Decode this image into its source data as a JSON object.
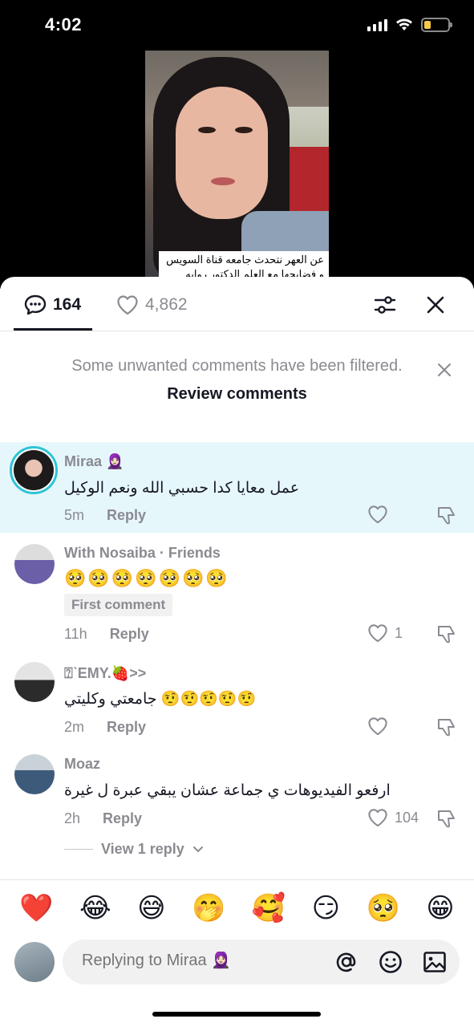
{
  "status": {
    "time": "4:02"
  },
  "video": {
    "caption_line1": "عن العهر نتحدث جامعه قناة السويس",
    "caption_line2": "و فضايحها مع العلم الدكتور روايه"
  },
  "tabs": {
    "comments_count": "164",
    "likes_count": "4,862"
  },
  "notice": {
    "text": "Some unwanted comments have been filtered.",
    "link": "Review comments"
  },
  "comments": [
    {
      "name": "Miraa 🧕🏻",
      "text": "عمل معايا كدا حسبي الله ونعم الوكيل",
      "time": "5m",
      "reply": "Reply",
      "likes": ""
    },
    {
      "name": "With Nosaiba · Friends",
      "emojis": "🥺🥺🥺🥺🥺🥺🥺",
      "badge": "First comment",
      "time": "11h",
      "reply": "Reply",
      "likes": "1"
    },
    {
      "name": "⍰ˋEMY.🍓>>",
      "text": "جامعتي وكليتي 🤨🤨🤨🤨🤨",
      "time": "2m",
      "reply": "Reply",
      "likes": ""
    },
    {
      "name": "Moaz",
      "text": "ارفعو الفيديوهات ي جماعة عشان يبقي عبرة ل غيرة",
      "time": "2h",
      "reply": "Reply",
      "likes": "104"
    }
  ],
  "view_reply": "View 1 reply",
  "reactions": [
    "❤️",
    "😂",
    "😅",
    "🤭",
    "🥰",
    "😏",
    "🥺",
    "😁"
  ],
  "input": {
    "placeholder": "Replying to Miraa 🧕🏻"
  },
  "colors": {
    "accent_ring": "#2ec4d6",
    "highlight_bg": "#e6f7fb",
    "muted": "#8a8b91"
  }
}
